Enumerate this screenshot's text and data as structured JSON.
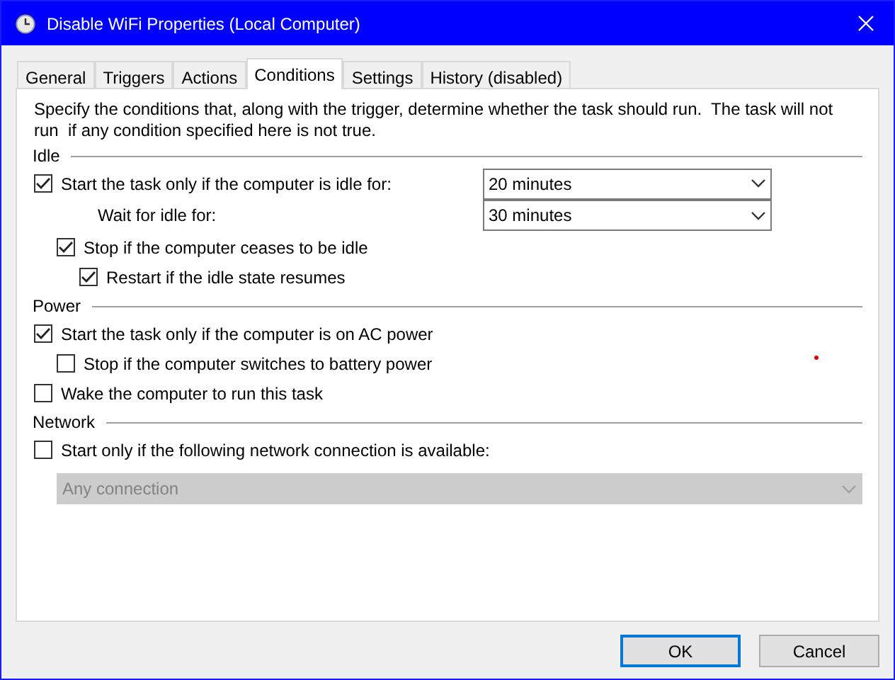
{
  "window": {
    "title": "Disable WiFi Properties (Local Computer)"
  },
  "tabs": [
    {
      "label": "General",
      "selected": false
    },
    {
      "label": "Triggers",
      "selected": false
    },
    {
      "label": "Actions",
      "selected": false
    },
    {
      "label": "Conditions",
      "selected": true
    },
    {
      "label": "Settings",
      "selected": false
    },
    {
      "label": "History (disabled)",
      "selected": false
    }
  ],
  "description": "Specify the conditions that, along with the trigger, determine whether the task should run.  The task will not run  if any condition specified here is not true.",
  "sections": [
    {
      "title": "Idle",
      "rows": [
        {
          "kind": "checkbox",
          "label": "Start the task only if the computer is idle for:",
          "checked": true,
          "combo": {
            "value": "20 minutes",
            "disabled": false
          },
          "children": [
            {
              "kind": "combo",
              "label": "Wait for idle for:",
              "combo": {
                "value": "30 minutes",
                "disabled": false
              }
            },
            {
              "kind": "checkbox",
              "label": "Stop if the computer ceases to be idle",
              "checked": true,
              "children": [
                {
                  "kind": "checkbox",
                  "label": "Restart if the idle state resumes",
                  "checked": true
                }
              ]
            }
          ]
        }
      ]
    },
    {
      "title": "Power",
      "rows": [
        {
          "kind": "checkbox",
          "label": "Start the task only if the computer is on AC power",
          "checked": true,
          "children": [
            {
              "kind": "checkbox",
              "label": "Stop if the computer switches to battery power",
              "checked": false
            }
          ]
        },
        {
          "kind": "checkbox",
          "label": "Wake the computer to run this task",
          "checked": false
        }
      ]
    },
    {
      "title": "Network",
      "rows": [
        {
          "kind": "checkbox",
          "label": "Start only if the following network connection is available:",
          "checked": false,
          "children": [
            {
              "kind": "combo",
              "combo": {
                "value": "Any connection",
                "disabled": true
              }
            }
          ]
        }
      ]
    }
  ],
  "buttons": [
    {
      "label": "OK",
      "selected": true
    },
    {
      "label": "Cancel",
      "selected": false
    }
  ]
}
